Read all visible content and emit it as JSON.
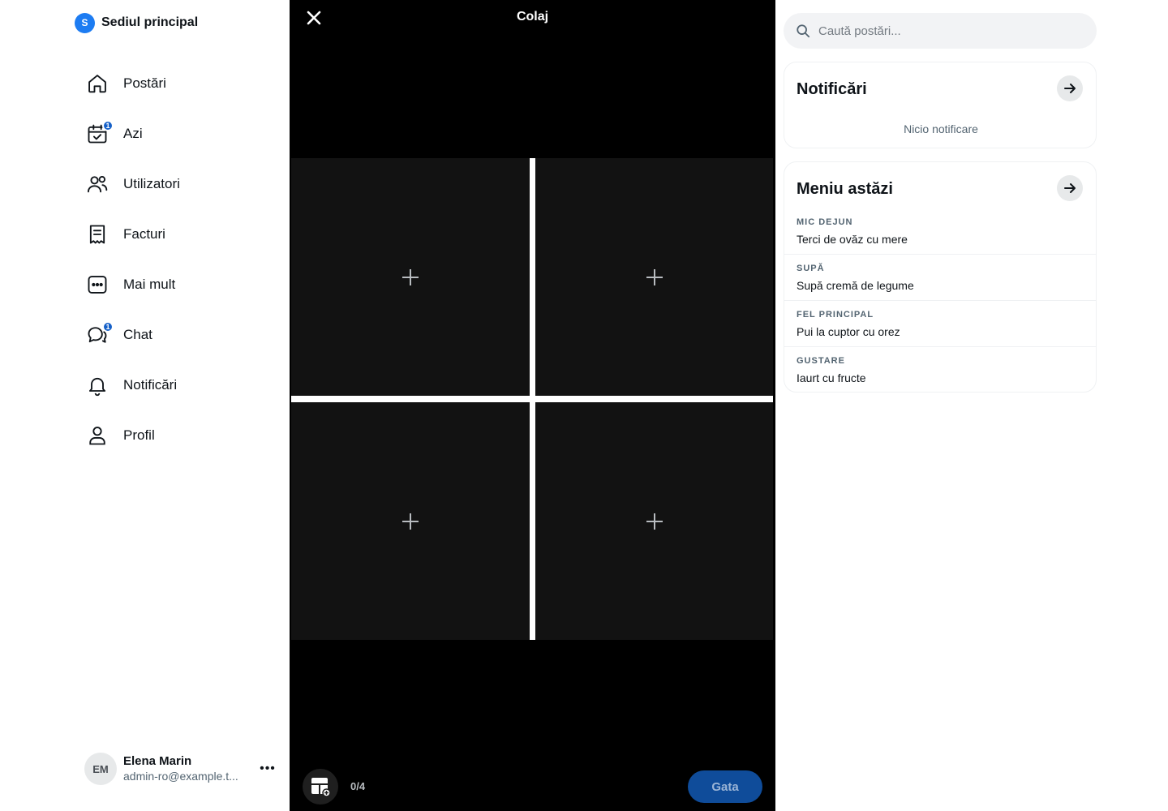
{
  "workspace": {
    "initial": "S",
    "name": "Sediul principal",
    "accent": "#1d7cf2"
  },
  "nav": {
    "items": [
      {
        "label": "Postări",
        "icon": "home-icon"
      },
      {
        "label": "Azi",
        "icon": "calendar-check-icon",
        "badge": "1"
      },
      {
        "label": "Utilizatori",
        "icon": "users-icon"
      },
      {
        "label": "Facturi",
        "icon": "receipt-icon"
      },
      {
        "label": "Mai mult",
        "icon": "more-box-icon"
      },
      {
        "label": "Chat",
        "icon": "chat-icon",
        "badge": "1"
      },
      {
        "label": "Notificări",
        "icon": "bell-icon"
      },
      {
        "label": "Profil",
        "icon": "person-icon"
      }
    ]
  },
  "account": {
    "initials": "EM",
    "name": "Elena Marin",
    "email": "admin-ro@example.t...",
    "more": "•••"
  },
  "collage": {
    "title": "Colaj",
    "count": "0/4",
    "done_label": "Gata",
    "done_color": "#0f4c9a"
  },
  "search": {
    "placeholder": "Caută postări..."
  },
  "notifications": {
    "title": "Notificări",
    "empty": "Nicio notificare"
  },
  "menu_today": {
    "title": "Meniu astăzi",
    "rows": [
      {
        "category": "MIC DEJUN",
        "dish": "Terci de ovăz cu mere"
      },
      {
        "category": "SUPĂ",
        "dish": "Supă cremă de legume"
      },
      {
        "category": "FEL PRINCIPAL",
        "dish": "Pui la cuptor cu orez"
      },
      {
        "category": "GUSTARE",
        "dish": "Iaurt cu fructe"
      }
    ]
  }
}
